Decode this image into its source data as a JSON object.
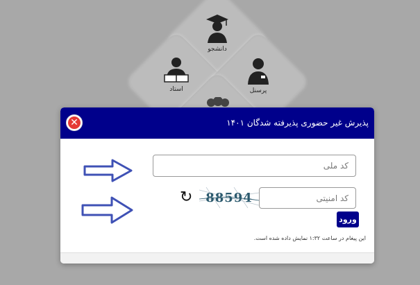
{
  "roles": {
    "student": "دانشجو",
    "teacher": "استاد",
    "staff": "پرسنل"
  },
  "modal": {
    "title": "پذیرش غیر حضوری پذیرفته شدگان ۱۴۰۱",
    "close_icon": "close-icon",
    "national_code_placeholder": "کد ملی",
    "security_code_placeholder": "کد امنیتی",
    "captcha_text": "88594",
    "submit_label": "ورود",
    "message": "این پیغام در ساعت ۱:۳۲ نمایش داده شده است."
  },
  "colors": {
    "header": "#00008b",
    "close": "#e53935",
    "arrow": "#3f51b5"
  }
}
